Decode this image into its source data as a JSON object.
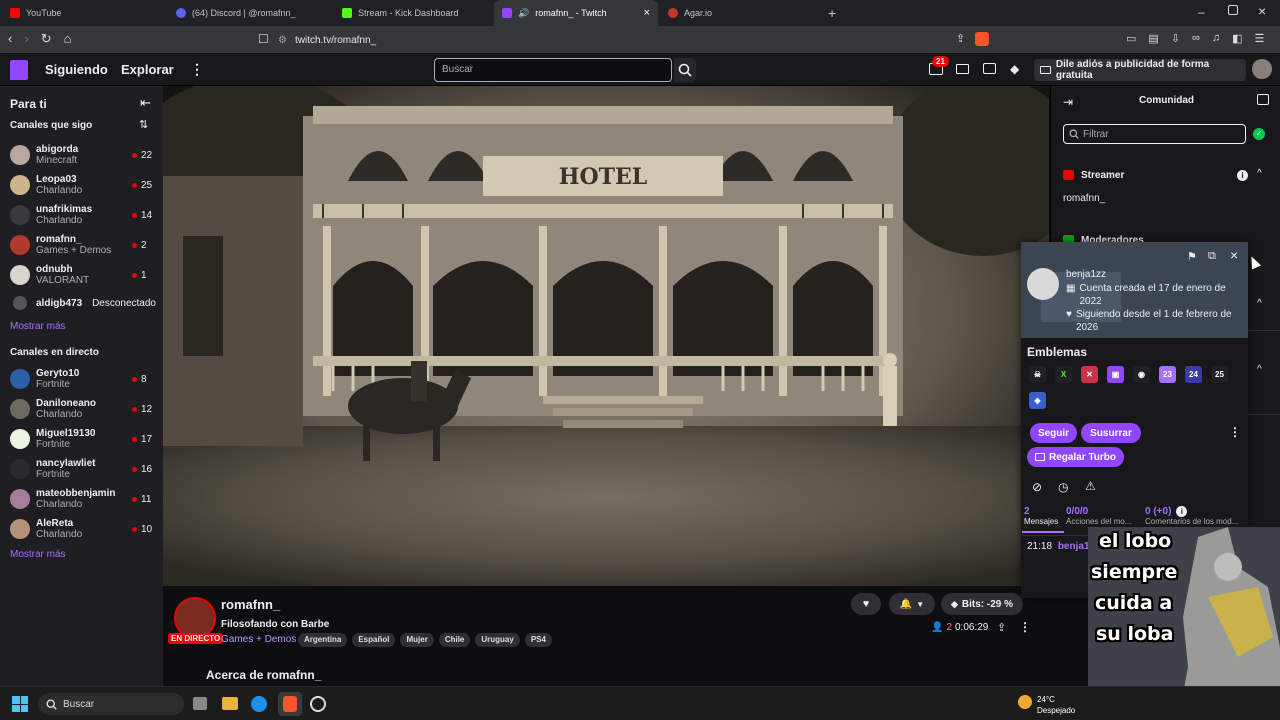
{
  "browser": {
    "tabs": [
      {
        "title": "YouTube",
        "color": "#ff0000"
      },
      {
        "title": "(64) Discord | @romafnn_",
        "color": "#5865f2"
      },
      {
        "title": "Stream - Kick Dashboard",
        "color": "#53fc18"
      },
      {
        "title": "romafnn_ - Twitch",
        "color": "#9146ff"
      },
      {
        "title": "Agar.io",
        "color": "#c0392b"
      }
    ],
    "new_tab": "+",
    "url": "twitch.tv/romafnn_"
  },
  "nav": {
    "following": "Siguiendo",
    "explore": "Explorar",
    "search_placeholder": "Buscar",
    "notif_count": "21",
    "ad_free": "Dile adiós a publicidad de forma gratuita"
  },
  "sidebar": {
    "title": "Para ti",
    "followed_header": "Canales que sigo",
    "followed": [
      {
        "name": "abigorda",
        "game": "Minecraft",
        "viewers": "22"
      },
      {
        "name": "Leopa03",
        "game": "Charlando",
        "viewers": "25"
      },
      {
        "name": "unafrikimas",
        "game": "Charlando",
        "viewers": "14"
      },
      {
        "name": "romafnn_",
        "game": "Games + Demos",
        "viewers": "2"
      },
      {
        "name": "odnubh",
        "game": "VALORANT",
        "viewers": "1"
      },
      {
        "name": "aldigb473",
        "status": "Desconectado"
      }
    ],
    "show_more": "Mostrar más",
    "live_header": "Canales en directo",
    "live": [
      {
        "name": "Geryto10",
        "game": "Fortnite",
        "viewers": "8"
      },
      {
        "name": "Daniloneano",
        "game": "Charlando",
        "viewers": "12"
      },
      {
        "name": "Miguel19130",
        "game": "Fortnite",
        "viewers": "17"
      },
      {
        "name": "nancylawliet",
        "game": "Fortnite",
        "viewers": "16"
      },
      {
        "name": "mateobbenjamin",
        "game": "Charlando",
        "viewers": "11"
      },
      {
        "name": "AleReta",
        "game": "Charlando",
        "viewers": "10"
      }
    ],
    "show_more_2": "Mostrar más"
  },
  "video": {
    "sign": "HOTEL"
  },
  "stream": {
    "channel": "romafnn_",
    "title": "Filosofando con Barbe",
    "live_label": "EN DIRECTO",
    "category": "Games + Demos",
    "tags": [
      "Argentina",
      "Español",
      "Mujer",
      "Chile",
      "Uruguay",
      "PS4"
    ],
    "bits": "Bits: -29 %",
    "viewers": "2",
    "uptime": "0:06:29",
    "about": "Acerca de romafnn_"
  },
  "chat": {
    "community": "Comunidad",
    "filter_placeholder": "Filtrar",
    "streamer_label": "Streamer",
    "streamer_name": "romafnn_",
    "mods_label": "Moderadores"
  },
  "usercard": {
    "username": "benja1zz",
    "created": "Cuenta creada el 17 de enero de 2022",
    "following": "Siguiendo desde el 1 de febrero de 2026",
    "badges_title": "Emblemas",
    "follow": "Seguir",
    "whisper": "Susurrar",
    "gift_turbo": "Regalar Turbo",
    "stats": [
      {
        "value": "2",
        "label": "Mensajes"
      },
      {
        "value": "0/0/0",
        "label": "Acciones del mo..."
      },
      {
        "value": "0 (+0)",
        "label": "Comentarios de los mod..."
      }
    ],
    "msg_time": "21:18",
    "msg_user": "benja1z"
  },
  "meme": {
    "lines": [
      "el lobo",
      "siempre",
      "cuida a",
      "su loba"
    ]
  },
  "taskbar": {
    "search": "Buscar",
    "weather_temp": "24°C",
    "weather_desc": "Despejado"
  }
}
